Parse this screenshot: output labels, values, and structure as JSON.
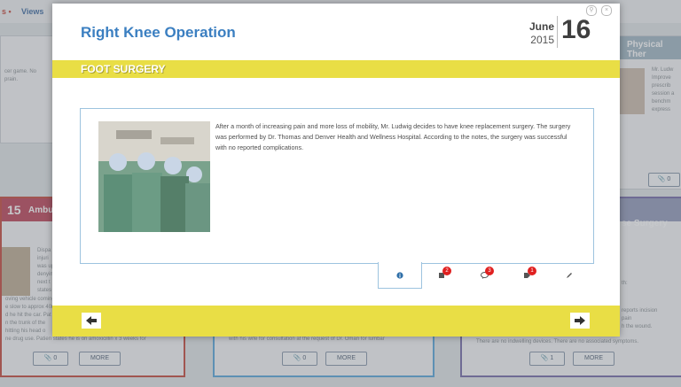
{
  "topbar": {
    "left_text": "s •",
    "views_label": "Views"
  },
  "background": {
    "left_card_text": [
      "cer game. No",
      "prain."
    ],
    "ambulance_card": {
      "date": "15",
      "title": "Ambul",
      "text": [
        "Dispa",
        "injuri",
        "was up",
        "denyin",
        "next t",
        "states",
        "oving vehicle coming",
        "e slow to approx 40m",
        "d he hit the car. Pat",
        "n the trunk of the",
        "hitting his head o",
        "ne drug use. Patien states he is on amoxicillin x 3 weeks for"
      ],
      "more_label": "MORE",
      "attach_count": "0"
    },
    "middle_card": {
      "more_label": "MORE",
      "attach_count": "0",
      "text": "with his wife for consultation at the request of Dr. Oman for lumbar"
    },
    "right_card_top": {
      "title": "Physical Ther",
      "text": [
        "Mr. Ludw",
        "Improve",
        "prescrib",
        "session a",
        "benchm",
        "express"
      ],
      "attach_count": "0"
    },
    "right_card_bottom": {
      "title": "se Surgery",
      "text": [
        "th:",
        "reports incision",
        "pain",
        "h the wound.",
        "There are no indwelling devices. There are no associated symptoms."
      ],
      "more_label": "MORE",
      "attach_count": "1"
    }
  },
  "modal": {
    "title": "Right Knee Operation",
    "date": {
      "month": "June",
      "year": "2015",
      "day": "16"
    },
    "category": "FOOT SURGERY",
    "body": "After a month of increasing pain and more loss of mobility, Mr. Ludwig decides to have knee replacement surgery. The surgery was performed by Dr. Thomas and Denver Health and Wellness Hospital. According to the notes, the surgery was successful with no reported complications.",
    "tabs": [
      {
        "icon": "info-icon",
        "badge": ""
      },
      {
        "icon": "document-icon",
        "badge": "2"
      },
      {
        "icon": "comment-icon",
        "badge": "3"
      },
      {
        "icon": "tag-icon",
        "badge": "1"
      },
      {
        "icon": "pencil-icon",
        "badge": ""
      }
    ]
  }
}
